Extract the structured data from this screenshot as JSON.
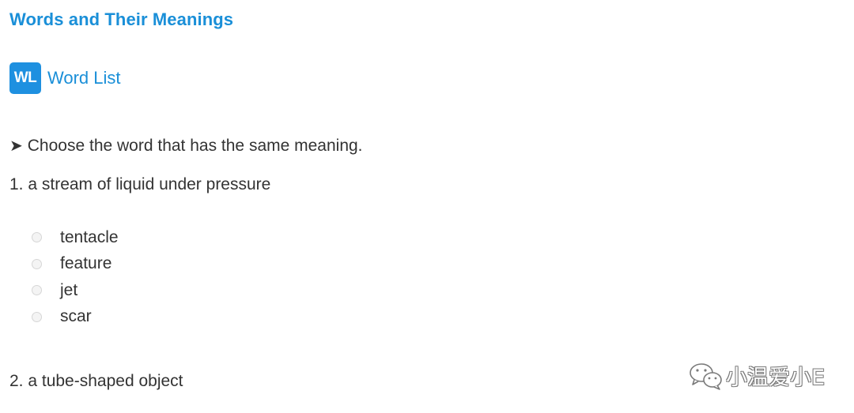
{
  "header": {
    "title": "Words and Their Meanings"
  },
  "word_list": {
    "badge": "WL",
    "label": "Word List"
  },
  "instruction": {
    "arrow": "➤",
    "text": "Choose the word that has the same meaning."
  },
  "questions": [
    {
      "prompt": "1. a stream of liquid under pressure",
      "options": [
        "tentacle",
        "feature",
        "jet",
        "scar"
      ]
    },
    {
      "prompt": "2. a tube-shaped object"
    }
  ],
  "watermark": {
    "icon": "wechat-icon",
    "text": "小温爱小E"
  },
  "colors": {
    "accent": "#1a8fd8",
    "badge": "#1e90e0",
    "text": "#333333"
  }
}
